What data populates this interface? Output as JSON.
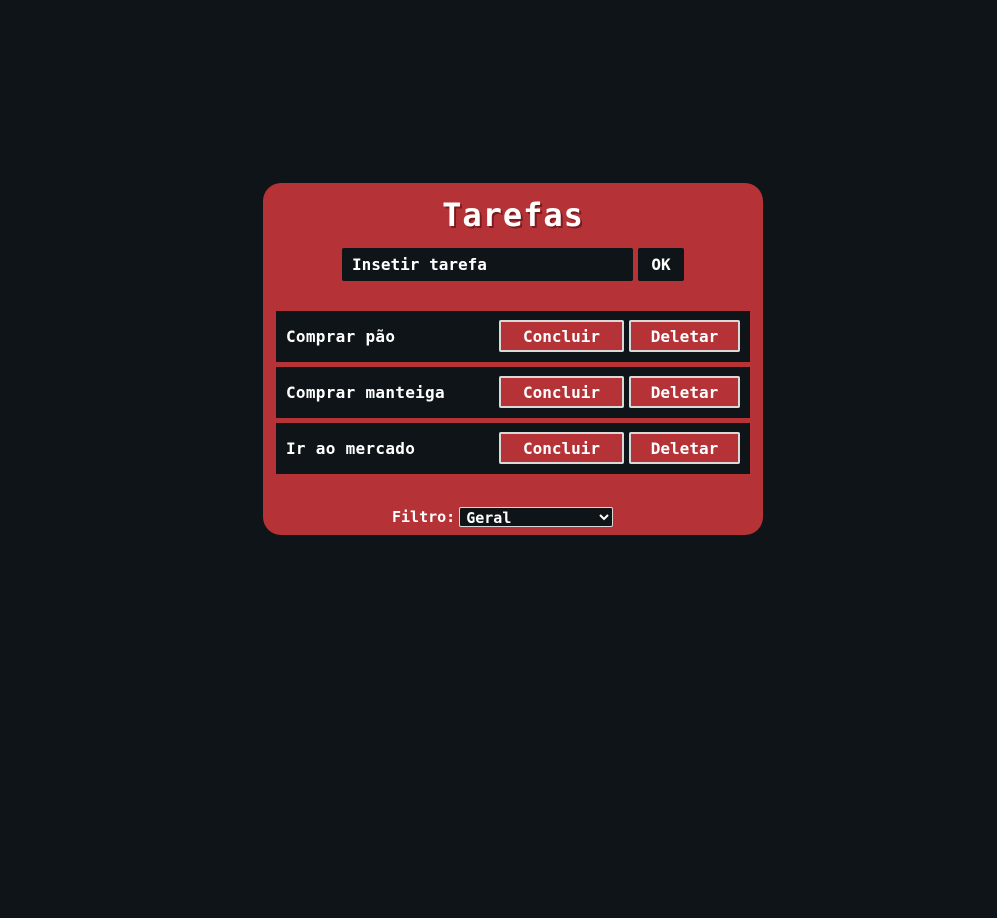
{
  "app": {
    "title": "Tarefas"
  },
  "form": {
    "input_value": "",
    "input_placeholder": "Insetir tarefa",
    "submit_label": "OK"
  },
  "tasks": [
    {
      "text": "Comprar pão",
      "conclude_label": "Concluir",
      "delete_label": "Deletar"
    },
    {
      "text": "Comprar manteiga",
      "conclude_label": "Concluir",
      "delete_label": "Deletar"
    },
    {
      "text": "Ir ao mercado",
      "conclude_label": "Concluir",
      "delete_label": "Deletar"
    }
  ],
  "filter": {
    "label": "Filtro:",
    "selected": "Geral"
  },
  "colors": {
    "background": "#0e1417",
    "card": "#b53336",
    "text": "#ffffff"
  }
}
